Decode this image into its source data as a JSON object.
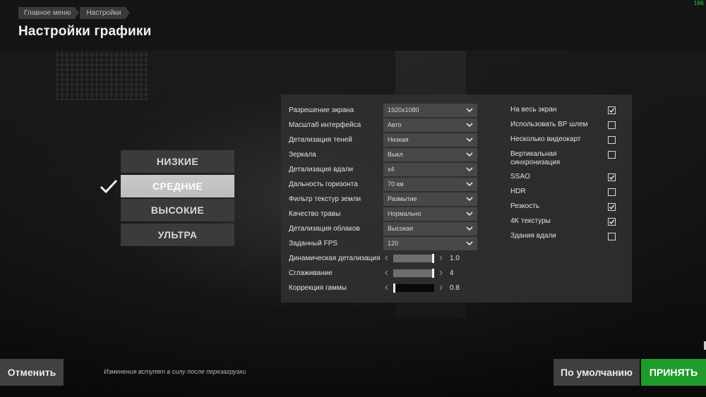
{
  "breadcrumb": [
    "Главное меню",
    "Настройки"
  ],
  "title": "Настройки графики",
  "fps_counter": "106",
  "presets": [
    {
      "label": "НИЗКИЕ",
      "selected": false
    },
    {
      "label": "СРЕДНИЕ",
      "selected": true
    },
    {
      "label": "ВЫСОКИЕ",
      "selected": false
    },
    {
      "label": "УЛЬТРА",
      "selected": false
    }
  ],
  "dropdowns": [
    {
      "label": "Разрешение экрана",
      "value": "1920x1080"
    },
    {
      "label": "Масштаб интерфейса",
      "value": "Авто"
    },
    {
      "label": "Детализация теней",
      "value": "Низкая"
    },
    {
      "label": "Зеркала",
      "value": "Выкл"
    },
    {
      "label": "Детализация вдали",
      "value": "x4"
    },
    {
      "label": "Дальность горизонта",
      "value": "70 км"
    },
    {
      "label": "Фильтр текстур земли",
      "value": "Размытие"
    },
    {
      "label": "Качество травы",
      "value": "Нормально"
    },
    {
      "label": "Детализация облаков",
      "value": "Высокая"
    },
    {
      "label": "Заданный FPS",
      "value": "120"
    }
  ],
  "sliders": [
    {
      "label": "Динамическая детализация",
      "value": "1.0",
      "fraction": 1.0
    },
    {
      "label": "Сглаживание",
      "value": "4",
      "fraction": 1.0
    },
    {
      "label": "Коррекция гаммы",
      "value": "0.8",
      "fraction": 0.0
    }
  ],
  "toggles": [
    {
      "label": "На весь экран",
      "checked": true
    },
    {
      "label": "Использовать ВР шлем",
      "checked": false
    },
    {
      "label": "Несколько видеокарт",
      "checked": false
    },
    {
      "label": "Вертикальная синхронизация",
      "checked": false
    },
    {
      "label": "SSAO",
      "checked": true
    },
    {
      "label": "HDR",
      "checked": false
    },
    {
      "label": "Резкость",
      "checked": true
    },
    {
      "label": "4K текстуры",
      "checked": true
    },
    {
      "label": "Здания вдали",
      "checked": false
    }
  ],
  "footer": {
    "cancel": "Отменить",
    "notice": "Изменения вступят в силу после перезагрузки",
    "default": "По умолчанию",
    "accept": "ПРИНЯТЬ"
  },
  "colors": {
    "accept": "#1f9b2c",
    "fps": "#27d33a"
  }
}
